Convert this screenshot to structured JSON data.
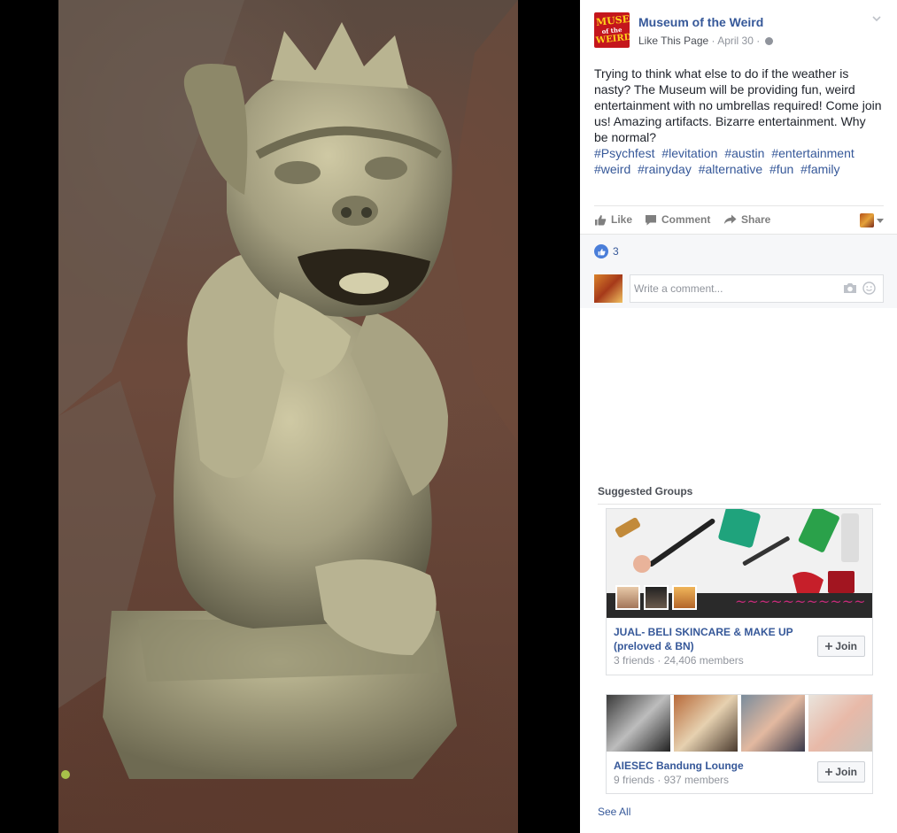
{
  "post": {
    "page_name": "Museum of the Weird",
    "logo_lines": [
      "MUSEUM",
      "of the",
      "WEIRD"
    ],
    "like_page": "Like This Page",
    "separator": "·",
    "date": "April 30",
    "body": "Trying to think what else to do if the weather is nasty? The Museum will be providing fun, weird entertainment with no umbrellas required! Come join us! Amazing artifacts. Bizarre entertainment. Why be normal?",
    "hashtags": [
      "#Psychfest",
      "#levitation",
      "#austin",
      "#entertainment",
      "#weird",
      "#rainyday",
      "#alternative",
      "#fun",
      "#family"
    ]
  },
  "actions": {
    "like": "Like",
    "comment": "Comment",
    "share": "Share"
  },
  "reactions": {
    "like_count": "3"
  },
  "comment_box": {
    "placeholder": "Write a comment..."
  },
  "suggested_groups": {
    "title": "Suggested Groups",
    "groups": [
      {
        "name": "JUAL- BELI SKINCARE & MAKE UP (preloved & BN)",
        "stats": "3 friends · 24,406 members",
        "join_label": "Join"
      },
      {
        "name": "AIESEC Bandung Lounge",
        "stats": "9 friends · 937 members",
        "join_label": "Join"
      }
    ],
    "see_all": "See All"
  },
  "colors": {
    "link_blue": "#365899",
    "like_blue": "#4a7ed9",
    "meta_gray": "#90949c",
    "logo_red": "#c4161c",
    "logo_yellow": "#ffd21a"
  },
  "icons": [
    "chevron-down-icon",
    "globe-icon",
    "like-thumb-icon",
    "comment-bubble-icon",
    "share-arrow-icon",
    "camera-icon",
    "smiley-icon",
    "plus-icon"
  ]
}
